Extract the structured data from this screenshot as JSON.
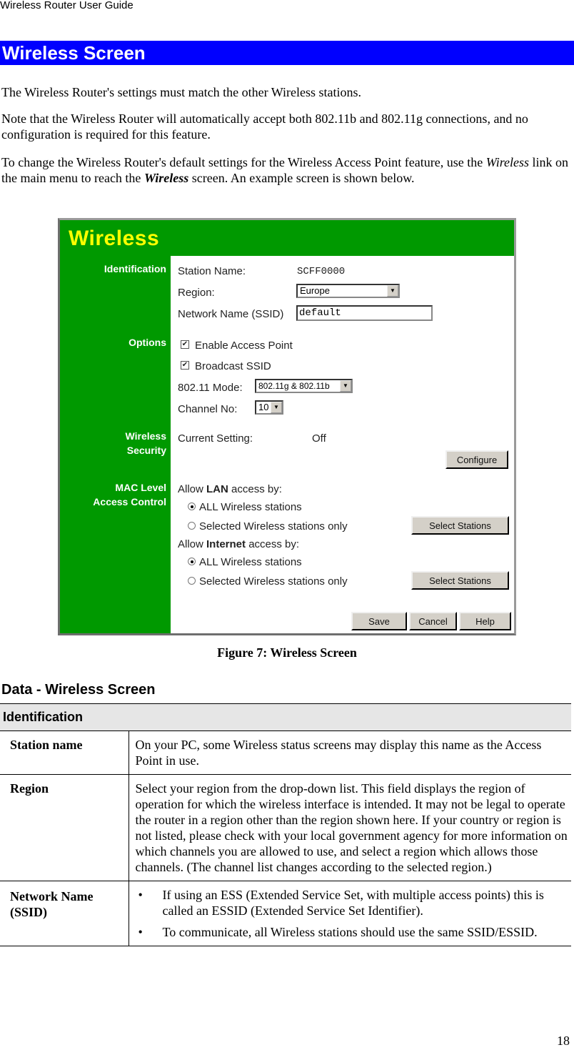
{
  "running_header": "Wireless Router User Guide",
  "section_title": "Wireless Screen",
  "paragraphs": {
    "p1": "The Wireless Router's settings must match the other Wireless stations.",
    "p2": "Note that the Wireless Router will automatically accept both 802.11b and 802.11g connections, and no configuration is required for this feature.",
    "p3_pre": "To change the Wireless Router's default settings for the Wireless Access Point feature, use the ",
    "p3_link": "Wireless",
    "p3_mid": " link on the main menu to reach the ",
    "p3_screen": "Wireless",
    "p3_post": " screen. An example screen is shown below."
  },
  "figure": {
    "title": "Wireless",
    "colors": {
      "background": "#009900",
      "title": "#ffff00",
      "panel": "#ffffff"
    },
    "sections": {
      "identification": "Identification",
      "options": "Options",
      "security_line1": "Wireless",
      "security_line2": "Security",
      "mac_line1": "MAC Level",
      "mac_line2": "Access Control"
    },
    "identification": {
      "station_label": "Station Name:",
      "station_value": "SCFF0000",
      "region_label": "Region:",
      "region_value": "Europe",
      "ssid_label": "Network Name (SSID)",
      "ssid_value": "default"
    },
    "options": {
      "enable_ap": {
        "label": "Enable Access Point",
        "checked": true
      },
      "broadcast_ssid": {
        "label": "Broadcast SSID",
        "checked": true
      },
      "mode_label": "802.11 Mode:",
      "mode_value": "802.11g & 802.11b",
      "channel_label": "Channel No:",
      "channel_value": "10"
    },
    "security": {
      "current_label": "Current Setting:",
      "current_value": "Off",
      "configure_button": "Configure"
    },
    "mac": {
      "lan_pre": "Allow ",
      "lan_bold": "LAN",
      "lan_post": " access by:",
      "internet_pre": "Allow ",
      "internet_bold": "Internet",
      "internet_post": " access by:",
      "all_stations": "ALL Wireless stations",
      "selected_stations": "Selected Wireless stations only",
      "lan_selected": "all",
      "internet_selected": "all",
      "select_button": "Select Stations"
    },
    "buttons": {
      "save": "Save",
      "cancel": "Cancel",
      "help": "Help"
    }
  },
  "caption": "Figure 7: Wireless Screen",
  "data_heading": "Data - Wireless Screen",
  "table": {
    "group": "Identification",
    "rows": [
      {
        "term": "Station name",
        "desc": "On your PC, some Wireless status screens may display this name as the Access Point in use."
      },
      {
        "term": "Region",
        "desc": "Select your region from the drop-down list. This field displays the region of operation for which the wireless interface is intended. It may not be legal to operate the router in a region other than the region shown here. If your country or region is not listed, please check with your local government agency for more information on which channels you are allowed to use, and select a region which allows those channels. (The channel list changes according to the selected region.)"
      },
      {
        "term": "Network Name (SSID)",
        "bullets": [
          "If using an ESS (Extended Service Set, with multiple access points) this is called an ESSID (Extended Service Set Identifier).",
          "To communicate, all Wireless stations should use the same SSID/ESSID."
        ]
      }
    ],
    "bullet_glyph": "•"
  },
  "page_number": "18"
}
